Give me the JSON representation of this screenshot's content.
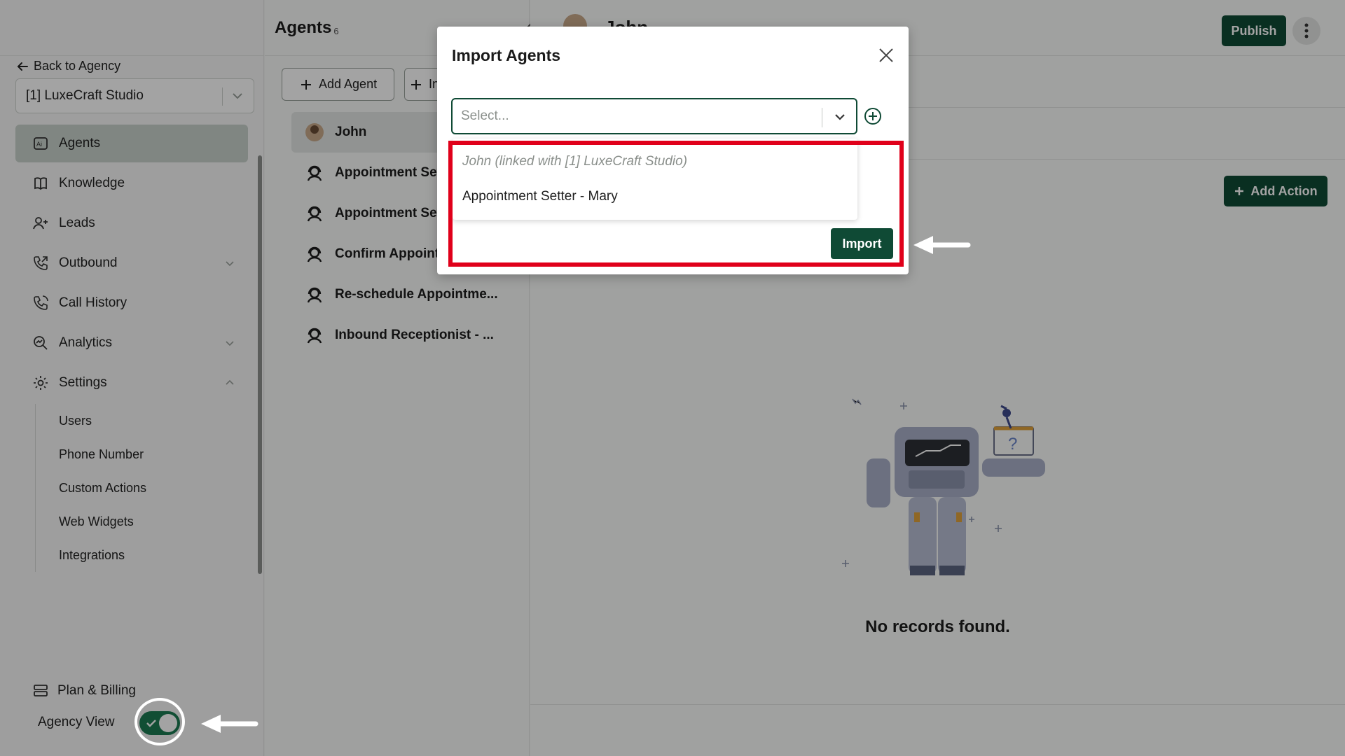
{
  "sidebar": {
    "back_label": "Back to Agency",
    "studio_select": "[1] LuxeCraft Studio",
    "nav": [
      {
        "label": "Agents"
      },
      {
        "label": "Knowledge"
      },
      {
        "label": "Leads"
      },
      {
        "label": "Outbound"
      },
      {
        "label": "Call History"
      },
      {
        "label": "Analytics"
      },
      {
        "label": "Settings"
      }
    ],
    "settings_sub": [
      "Users",
      "Phone Number",
      "Custom Actions",
      "Web Widgets",
      "Integrations"
    ],
    "plan_label": "Plan & Billing",
    "agency_view_label": "Agency View",
    "agency_view_on": true
  },
  "agents_panel": {
    "title": "Agents",
    "count": "6",
    "add_agent_label": "Add Agent",
    "import_label_partial": "In",
    "agents": [
      "John",
      "Appointment Setter - Mary",
      "Appointment Setter - John",
      "Confirm Appointment",
      "Re-schedule Appointme...",
      "Inbound Receptionist - ..."
    ]
  },
  "main": {
    "agent_name": "John",
    "publish_label": "Publish",
    "add_action_label": "Add Action",
    "empty_text": "No records found."
  },
  "modal": {
    "title": "Import Agents",
    "select_placeholder": "Select...",
    "options": [
      {
        "label": "John (linked with [1] LuxeCraft Studio)",
        "disabled": true
      },
      {
        "label": "Appointment Setter - Mary",
        "disabled": false
      }
    ],
    "import_label": "Import"
  },
  "colors": {
    "brand_primary": "#0f4a35",
    "highlight_red": "#e0001a",
    "toggle_on": "#1c7a52"
  }
}
